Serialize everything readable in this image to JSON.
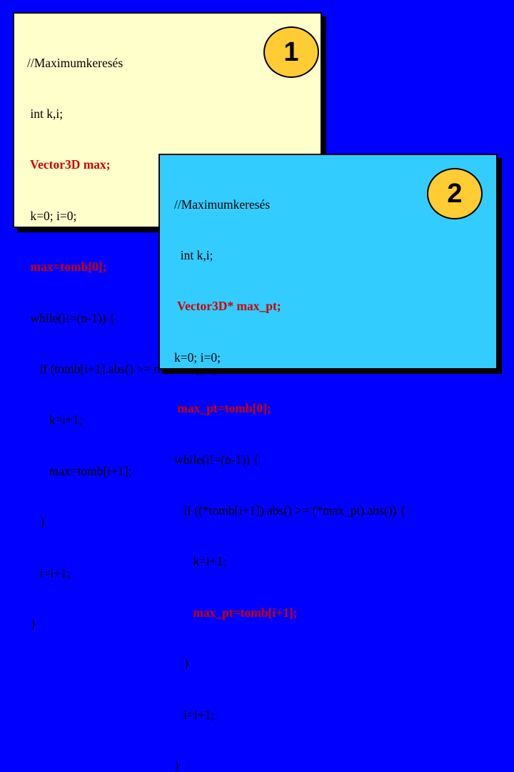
{
  "slide": {
    "panel1": {
      "badge": "1",
      "lines": [
        "//Maximumkeresés",
        " int k,i;",
        " Vector3D max;",
        " k=0; i=0;",
        " max=tomb[0];",
        " while(i!=(n-1)) {",
        "    if (tomb[i+1].abs() >= max.abs()) {",
        "       k=i+1;",
        "       max=tomb[i+1];",
        "    }",
        "    i=i+1;",
        " }"
      ]
    },
    "panel2": {
      "badge": "2",
      "lines": [
        "//Maximumkeresés",
        "  int k,i;",
        " Vector3D* max_pt;",
        "k=0; i=0;",
        " max_pt=tomb[0];",
        "while(i!=(n-1)) {",
        "   if ((*tomb[i+1]).abs() >= (*max_pt).abs()) {",
        "      k=i+1;",
        "      max_pt=tomb[i+1];",
        "   }",
        "   i=i+1;",
        "}"
      ]
    },
    "colors": {
      "background": "#0000ff",
      "panel1_fill": "#ffffcc",
      "panel2_fill": "#33ccff",
      "badge_fill": "#ffcc33",
      "highlight_text": "#cc0000"
    }
  }
}
